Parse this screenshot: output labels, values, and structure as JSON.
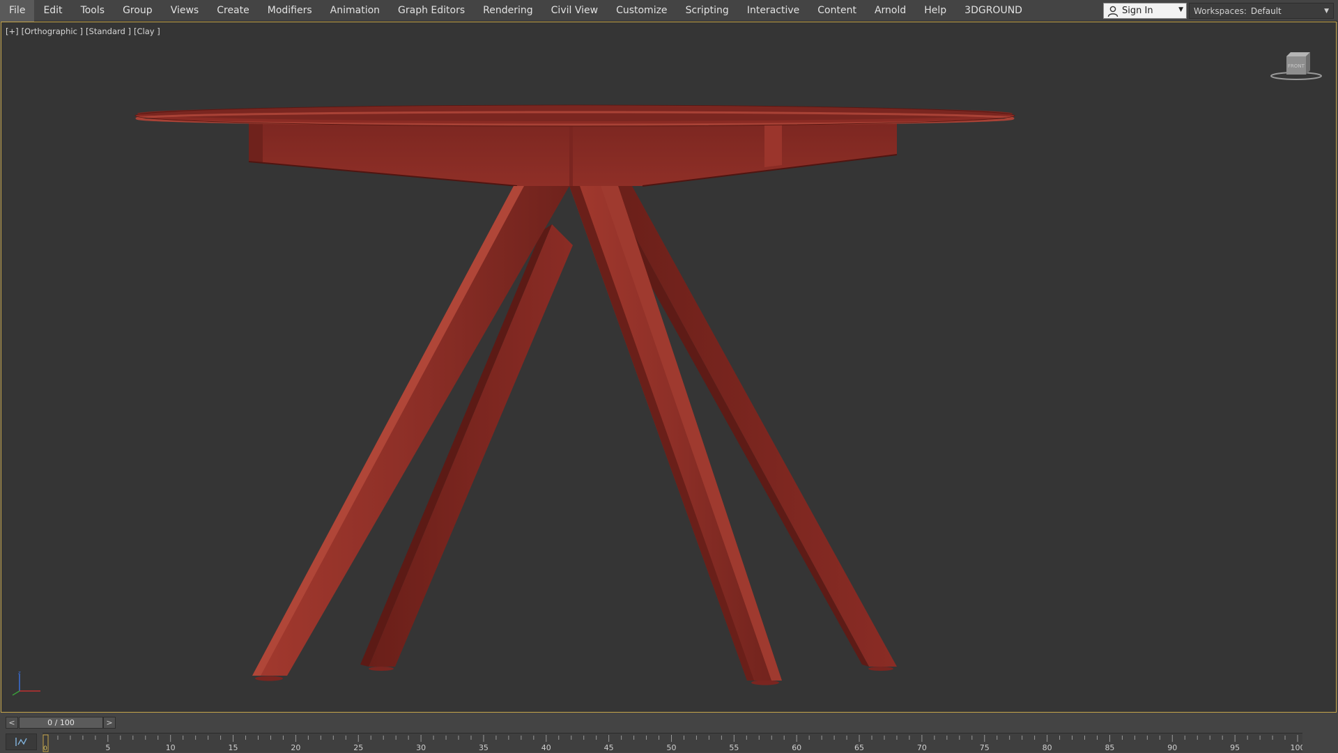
{
  "menu": {
    "items": [
      "File",
      "Edit",
      "Tools",
      "Group",
      "Views",
      "Create",
      "Modifiers",
      "Animation",
      "Graph Editors",
      "Rendering",
      "Civil View",
      "Customize",
      "Scripting",
      "Interactive",
      "Content",
      "Arnold",
      "Help",
      "3DGROUND"
    ]
  },
  "account": {
    "sign_in_label": "Sign In",
    "icon": "user-icon"
  },
  "workspaces": {
    "label": "Workspaces:",
    "value": "Default"
  },
  "viewport": {
    "label_parts": [
      "[+]",
      "[Orthographic ]",
      "[Standard ]",
      "[Clay ]"
    ],
    "object_color": "#8a2b24",
    "background_color": "#353535",
    "active_border_color": "#c8a74a",
    "viewcube_icon": "viewcube-icon",
    "axis_icon": "axis-tripod-icon"
  },
  "time_slider": {
    "prev_label": "<",
    "next_label": ">",
    "frame_display": "0 / 100"
  },
  "track_bar": {
    "ticks_labeled": [
      5,
      10,
      15,
      20,
      25,
      30,
      35,
      40,
      45,
      50,
      55,
      60,
      65,
      70,
      75,
      80,
      85,
      90,
      95,
      100
    ],
    "current_frame_marker": "0"
  }
}
